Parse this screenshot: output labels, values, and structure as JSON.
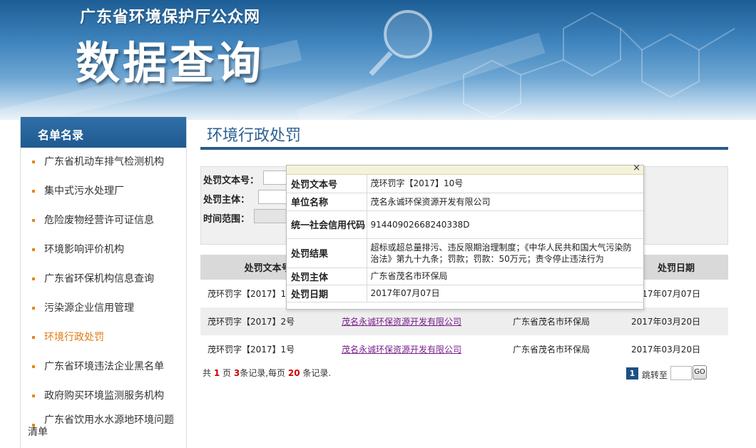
{
  "banner": {
    "subtitle": "广东省环境保护厅公众网",
    "title": "数据查询"
  },
  "sidebar": {
    "title": "名单名录",
    "items": [
      {
        "label": "广东省机动车排气检测机构"
      },
      {
        "label": "集中式污水处理厂"
      },
      {
        "label": "危险废物经营许可证信息"
      },
      {
        "label": "环境影响评价机构"
      },
      {
        "label": "广东省环保机构信息查询"
      },
      {
        "label": "污染源企业信用管理"
      },
      {
        "label": "环境行政处罚"
      },
      {
        "label": "广东省环境违法企业黑名单"
      },
      {
        "label": "政府购买环境监测服务机构"
      },
      {
        "label": "广东省饮用水水源地环境问题",
        "label_cont": "清单"
      }
    ],
    "active_index": 6
  },
  "main": {
    "title": "环境行政处罚"
  },
  "search": {
    "doc_label": "处罚文本号：",
    "subject_label": "处罚主体：",
    "time_label": "时间范围："
  },
  "results": {
    "headers": [
      "处罚文本号",
      "",
      "",
      "处罚日期"
    ],
    "rows": [
      {
        "doc": "茂环罚字【2017】10号",
        "unit": "",
        "subject": "",
        "date": "2017年07月07日"
      },
      {
        "doc": "茂环罚字【2017】2号",
        "unit": "茂名永诚环保资源开发有限公司",
        "subject": "广东省茂名市环保局",
        "date": "2017年03月20日"
      },
      {
        "doc": "茂环罚字【2017】1号",
        "unit": "茂名永诚环保资源开发有限公司",
        "subject": "广东省茂名市环保局",
        "date": "2017年03月20日"
      }
    ]
  },
  "pager": {
    "prefix": "共",
    "pages": "1",
    "pages_suffix": "页",
    "records": "3",
    "records_suffix": "条记录,每页",
    "per_page": "20",
    "per_page_suffix": "条记录.",
    "current_page": "1",
    "jump_label": "跳转至",
    "go_label": "GO"
  },
  "popup": {
    "close": "×",
    "rows": [
      {
        "key": "处罚文本号",
        "value": "茂环罚字【2017】10号"
      },
      {
        "key": "单位名称",
        "value": "茂名永诚环保资源开发有限公司"
      },
      {
        "key": "统一社会信用代码",
        "value": "91440902668240338D"
      },
      {
        "key": "处罚结果",
        "value": "超标或超总量排污、违反限期治理制度；《中华人民共和国大气污染防治法》第九十九条；罚款；罚款：50万元；责令停止违法行为"
      },
      {
        "key": "处罚主体",
        "value": "广东省茂名市环保局"
      },
      {
        "key": "处罚日期",
        "value": "2017年07月07日"
      }
    ]
  },
  "colors": {
    "accent_blue": "#2a5b8d",
    "active_orange": "#e07b14",
    "link_purple": "#7a1f8c",
    "highlight_red": "#d10000"
  }
}
